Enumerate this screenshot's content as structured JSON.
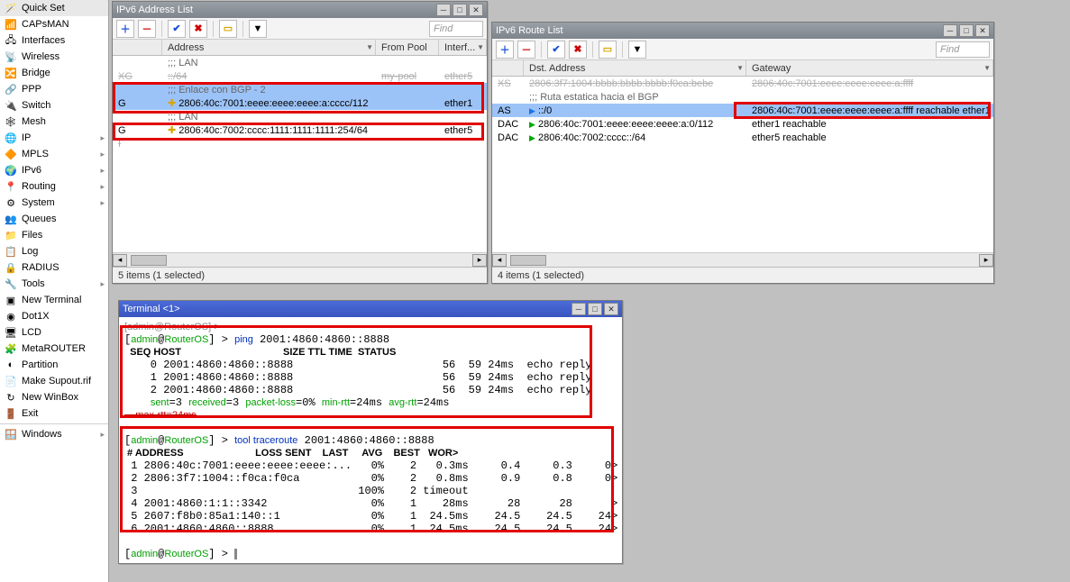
{
  "sidebar": [
    {
      "icon": "🪄",
      "label": "Quick Set"
    },
    {
      "icon": "📶",
      "label": "CAPsMAN"
    },
    {
      "icon": "🖧",
      "label": "Interfaces"
    },
    {
      "icon": "📡",
      "label": "Wireless"
    },
    {
      "icon": "🔀",
      "label": "Bridge"
    },
    {
      "icon": "🔗",
      "label": "PPP"
    },
    {
      "icon": "🔌",
      "label": "Switch"
    },
    {
      "icon": "🕸",
      "label": "Mesh"
    },
    {
      "icon": "🌐",
      "label": "IP",
      "arrow": true
    },
    {
      "icon": "🔶",
      "label": "MPLS",
      "arrow": true
    },
    {
      "icon": "🌍",
      "label": "IPv6",
      "arrow": true
    },
    {
      "icon": "📍",
      "label": "Routing",
      "arrow": true
    },
    {
      "icon": "⚙",
      "label": "System",
      "arrow": true
    },
    {
      "icon": "👥",
      "label": "Queues"
    },
    {
      "icon": "📁",
      "label": "Files"
    },
    {
      "icon": "📋",
      "label": "Log"
    },
    {
      "icon": "🔒",
      "label": "RADIUS"
    },
    {
      "icon": "🔧",
      "label": "Tools",
      "arrow": true
    },
    {
      "icon": "▣",
      "label": "New Terminal"
    },
    {
      "icon": "◉",
      "label": "Dot1X"
    },
    {
      "icon": "🖥",
      "label": "LCD"
    },
    {
      "icon": "🧩",
      "label": "MetaROUTER"
    },
    {
      "icon": "◐",
      "label": "Partition"
    },
    {
      "icon": "📄",
      "label": "Make Supout.rif"
    },
    {
      "icon": "↻",
      "label": "New WinBox"
    },
    {
      "icon": "🚪",
      "label": "Exit"
    },
    {
      "sep": true
    },
    {
      "icon": "🪟",
      "label": "Windows",
      "arrow": true
    }
  ],
  "addrWin": {
    "title": "IPv6 Address List",
    "headers": {
      "addr": "Address",
      "pool": "From Pool",
      "iface": "Interf..."
    },
    "find": "Find",
    "status": "5 items (1 selected)",
    "rows": [
      {
        "flag": "",
        "type": "comment",
        "text": ";;; LAN"
      },
      {
        "flag": "XG",
        "addr": "::/64",
        "pool": "my-pool",
        "iface": "ether5",
        "strike": true
      },
      {
        "flag": "",
        "type": "comment",
        "text": ";;; Enlace con BGP - 2",
        "sel": true
      },
      {
        "flag": "G",
        "addr": "2806:40c:7001:eeee:eeee:eeee:a:cccc/112",
        "iface": "ether1",
        "sel": true,
        "iconColor": "#d9a400"
      },
      {
        "flag": "",
        "type": "comment",
        "text": ";;; LAN"
      },
      {
        "flag": "G",
        "addr": "2806:40c:7002:cccc:1111:1111:1111:254/64",
        "iface": "ether5",
        "iconColor": "#d9a400"
      },
      {
        "flag": "I",
        "addr": "",
        "strike": true
      }
    ]
  },
  "routeWin": {
    "title": "IPv6 Route List",
    "headers": {
      "dst": "Dst. Address",
      "gw": "Gateway"
    },
    "find": "Find",
    "status": "4 items (1 selected)",
    "rows": [
      {
        "flag": "XS",
        "dst": "2806:3f7:1004:bbbb:bbbb:bbbb:f0ca:bebe",
        "gw": "2806:40c:7001:eeee:eeee:eeee:a:ffff",
        "strike": true
      },
      {
        "flag": "",
        "type": "comment",
        "text": ";;; Ruta estatica hacia el BGP"
      },
      {
        "flag": "AS",
        "dst": "::/0",
        "gw": "2806:40c:7001:eeee:eeee:eeee:a:ffff reachable ether1",
        "sel": true,
        "iconColor": "#1a73e8"
      },
      {
        "flag": "DAC",
        "dst": "2806:40c:7001:eeee:eeee:eeee:a:0/112",
        "gw": "ether1 reachable",
        "iconColor": "#0a0"
      },
      {
        "flag": "DAC",
        "dst": "2806:40c:7002:cccc::/64",
        "gw": "ether5 reachable",
        "iconColor": "#0a0"
      }
    ]
  },
  "term": {
    "title": "Terminal <1>",
    "prompt_user": "admin",
    "prompt_host": "RouterOS",
    "ping_cmd": "ping 2001:4860:4860::8888",
    "ping_header": "  SEQ HOST                                     SIZE TTL TIME  STATUS",
    "ping_rows": [
      "    0 2001:4860:4860::8888                       56  59 24ms  echo reply",
      "    1 2001:4860:4860::8888                       56  59 24ms  echo reply",
      "    2 2001:4860:4860::8888                       56  59 24ms  echo reply"
    ],
    "ping_summary_pre": "    ",
    "ping_sent": "sent",
    "ping_sent_v": "=3 ",
    "ping_recv": "received",
    "ping_recv_v": "=3 ",
    "ping_loss": "packet-loss",
    "ping_loss_v": "=0% ",
    "ping_min": "min-rtt",
    "ping_min_v": "=24ms ",
    "ping_avg": "avg-rtt",
    "ping_avg_v": "=24ms",
    "ping_max": "    max-rtt=24ms",
    "tr_cmd": "tool traceroute 2001:4860:4860::8888",
    "tr_header": " # ADDRESS                          LOSS SENT    LAST     AVG    BEST   WOR>",
    "tr_rows": [
      " 1 2806:40c:7001:eeee:eeee:eeee:...   0%    2   0.3ms     0.4     0.3     0>",
      " 2 2806:3f7:1004::f0ca:f0ca           0%    2   0.8ms     0.9     0.8     0>",
      " 3                                  100%    2 timeout",
      " 4 2001:4860:1:1::3342                0%    1    28ms      28      28      >",
      " 5 2607:f8b0:85a1:140::1              0%    1  24.5ms    24.5    24.5    24>",
      " 6 2001:4860:4860::8888               0%    1  24.5ms    24.5    24.5    24>"
    ],
    "prompt_end": "> "
  }
}
